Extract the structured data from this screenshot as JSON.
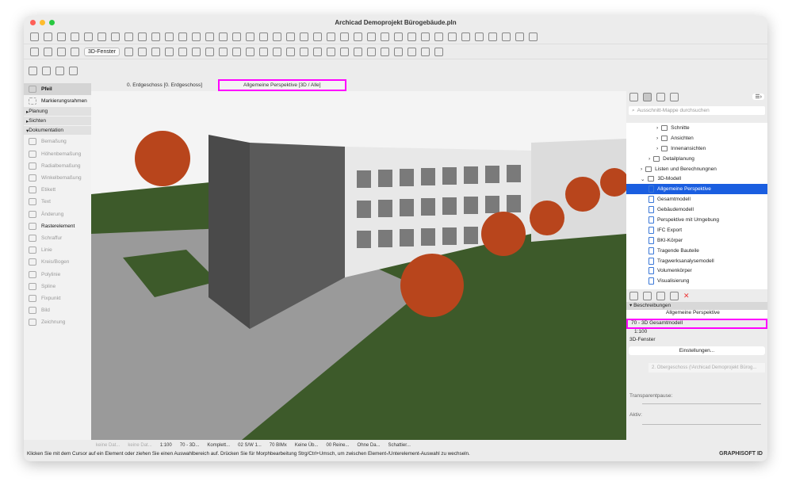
{
  "window": {
    "title": "Archicad Demoprojekt Bürogebäude.pln"
  },
  "toolbar": {
    "view3d_label": "3D-Fenster"
  },
  "tabs": [
    {
      "label": "0. Erdgeschoss [0. Erdgeschoss]"
    },
    {
      "label": "Allgemeine Perspektive [3D / Alle]"
    }
  ],
  "left_panel": {
    "tools_top": [
      "Pfeil",
      "Markierungsrahmen"
    ],
    "sections": [
      "Planung",
      "Sichten",
      "Dokumentation"
    ],
    "doc_tools": [
      "Bemaßung",
      "Höhenbemaßung",
      "Radialbemaßung",
      "Winkelbemaßung",
      "Etikett",
      "Text",
      "Änderung",
      "Rasterelement",
      "Schraffur",
      "Linie",
      "Kreis/Bogen",
      "Polylinie",
      "Spline",
      "Fixpunkt",
      "Bild",
      "Zeichnung"
    ]
  },
  "navigator": {
    "search_placeholder": "Ausschnitt-Mappe durchsuchen",
    "tree": [
      {
        "label": "Schnitte",
        "level": 2
      },
      {
        "label": "Ansichten",
        "level": 2
      },
      {
        "label": "Innenansichten",
        "level": 2
      },
      {
        "label": "Detailplanung",
        "level": 1
      },
      {
        "label": "Listen und Berechnungnen",
        "level": 0
      },
      {
        "label": "3D-Modell",
        "level": 0
      },
      {
        "label": "Allgemeine Perspektive",
        "level": 1,
        "selected": true
      },
      {
        "label": "Gesamtmodell",
        "level": 1
      },
      {
        "label": "Gebäudemodell",
        "level": 1
      },
      {
        "label": "Perspektive mit Umgebung",
        "level": 1
      },
      {
        "label": "IFC Export",
        "level": 1
      },
      {
        "label": "BKI-Körper",
        "level": 1
      },
      {
        "label": "Tragende Bauteile",
        "level": 1
      },
      {
        "label": "Tragwerksanalysemodell",
        "level": 1
      },
      {
        "label": "Volumenkörper",
        "level": 1
      },
      {
        "label": "Visualisierung",
        "level": 1
      }
    ]
  },
  "properties": {
    "section_label": "Beschreibungen",
    "name": "Allgemeine Perspektive",
    "layer_combo": "70 - 3D Gesamtmodell",
    "scale": "1:100",
    "window_type": "3D-Fenster",
    "settings_button": "Einstellungen...",
    "source_view": "2. Obergeschoss (!Archicad Demoprojekt Bürog...",
    "transparent_label": "Transparentpause:",
    "active_label": "Aktiv:"
  },
  "statusbar": {
    "items": [
      "keine Dat...",
      "keine Dat...",
      "1:100",
      "70 - 3D...",
      "Komplett...",
      "02 S/W 1...",
      "70 BIMx",
      "Keine Üb...",
      "00 Reine...",
      "Ohne Da...",
      "Schattier..."
    ],
    "message": "Klicken Sie mit dem Cursor auf ein Element oder ziehen Sie einen Auswahlbereich auf. Drücken Sie für Morphbearbeitung Strg/Ctrl+Umsch, um zwischen Element-/Unterelement-Auswahl zu wechseln.",
    "brand": "GRAPHISOFT ID"
  },
  "colors": {
    "accent": "#1a5ee0",
    "highlight": "#ff00ff",
    "grass": "#3d5a2a",
    "tree": "#b8451c"
  }
}
